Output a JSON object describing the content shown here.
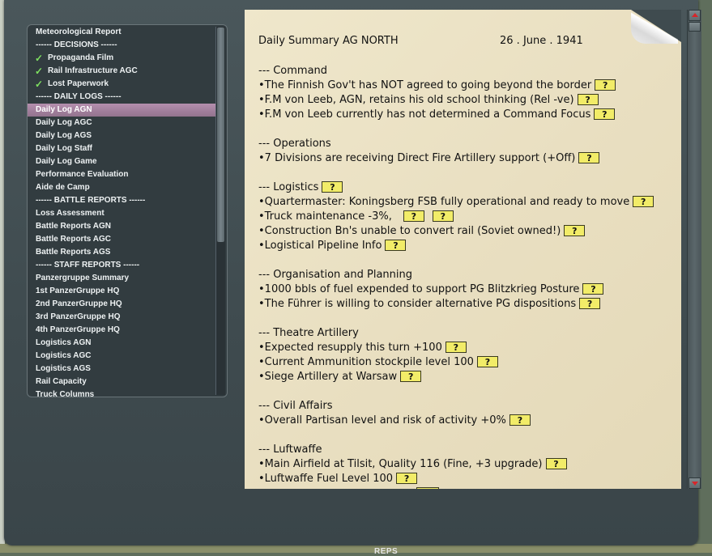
{
  "menu": {
    "items": [
      {
        "label": "Meteorological Report",
        "kind": "item"
      },
      {
        "label": "------ DECISIONS ------",
        "kind": "header"
      },
      {
        "label": "Propaganda Film",
        "kind": "checked"
      },
      {
        "label": "Rail Infrastructure AGC",
        "kind": "checked"
      },
      {
        "label": "Lost Paperwork",
        "kind": "checked"
      },
      {
        "label": "------ DAILY LOGS ------",
        "kind": "header"
      },
      {
        "label": "Daily Log AGN",
        "kind": "selected"
      },
      {
        "label": "Daily Log AGC",
        "kind": "item"
      },
      {
        "label": "Daily Log AGS",
        "kind": "item"
      },
      {
        "label": "Daily Log Staff",
        "kind": "item"
      },
      {
        "label": "Daily Log Game",
        "kind": "item"
      },
      {
        "label": "Performance Evaluation",
        "kind": "item"
      },
      {
        "label": "Aide de Camp",
        "kind": "item"
      },
      {
        "label": "------ BATTLE REPORTS ------",
        "kind": "header"
      },
      {
        "label": "Loss Assessment",
        "kind": "item"
      },
      {
        "label": "Battle Reports AGN",
        "kind": "item"
      },
      {
        "label": "Battle Reports AGC",
        "kind": "item"
      },
      {
        "label": "Battle Reports AGS",
        "kind": "item"
      },
      {
        "label": "------ STAFF REPORTS ------",
        "kind": "header"
      },
      {
        "label": "Panzergruppe Summary",
        "kind": "item"
      },
      {
        "label": "1st PanzerGruppe HQ",
        "kind": "item"
      },
      {
        "label": "2nd PanzerGruppe HQ",
        "kind": "item"
      },
      {
        "label": "3rd PanzerGruppe HQ",
        "kind": "item"
      },
      {
        "label": "4th PanzerGruppe HQ",
        "kind": "item"
      },
      {
        "label": "Logistics AGN",
        "kind": "item"
      },
      {
        "label": "Logistics AGC",
        "kind": "item"
      },
      {
        "label": "Logistics AGS",
        "kind": "item"
      },
      {
        "label": "Rail Capacity",
        "kind": "item"
      },
      {
        "label": "Truck Columns",
        "kind": "item"
      }
    ],
    "check_glyph": "✓"
  },
  "document": {
    "title": "Daily Summary AG NORTH",
    "date": "26 . June . 1941",
    "help_label": "?",
    "lines": [
      {
        "text": "--- Command",
        "buttons": 0
      },
      {
        "text": "•The Finnish Gov't has NOT agreed to going beyond the border",
        "buttons": 1
      },
      {
        "text": "•F.M von Leeb, AGN, retains his old school thinking (Rel -ve)",
        "buttons": 1
      },
      {
        "text": "•F.M von Leeb currently has not determined a Command Focus",
        "buttons": 1
      },
      {
        "text": "",
        "buttons": 0
      },
      {
        "text": "--- Operations",
        "buttons": 0
      },
      {
        "text": "•7 Divisions are receiving Direct Fire Artillery support (+Off)",
        "buttons": 1
      },
      {
        "text": "",
        "buttons": 0
      },
      {
        "text": "--- Logistics",
        "buttons": 1
      },
      {
        "text": "•Quartermaster: Koningsberg FSB fully operational and ready to move",
        "buttons": 1
      },
      {
        "text": "•Truck maintenance -3%,",
        "buttons": 2
      },
      {
        "text": "•Construction Bn's unable to convert rail (Soviet owned!)",
        "buttons": 1
      },
      {
        "text": "•Logistical Pipeline Info",
        "buttons": 1
      },
      {
        "text": "",
        "buttons": 0
      },
      {
        "text": "--- Organisation and Planning",
        "buttons": 0
      },
      {
        "text": "•1000 bbls of fuel expended to support PG Blitzkrieg Posture",
        "buttons": 1
      },
      {
        "text": "•The Führer is willing to consider alternative PG dispositions",
        "buttons": 1
      },
      {
        "text": "",
        "buttons": 0
      },
      {
        "text": "--- Theatre Artillery",
        "buttons": 0
      },
      {
        "text": "•Expected resupply this turn +100",
        "buttons": 1
      },
      {
        "text": "•Current Ammunition stockpile level 100",
        "buttons": 1
      },
      {
        "text": "•Siege Artillery at Warsaw",
        "buttons": 1
      },
      {
        "text": "",
        "buttons": 0
      },
      {
        "text": "--- Civil Affairs",
        "buttons": 0
      },
      {
        "text": "•Overall Partisan level and risk of activity +0%",
        "buttons": 1
      },
      {
        "text": "",
        "buttons": 0
      },
      {
        "text": "--- Luftwaffe",
        "buttons": 0
      },
      {
        "text": "•Main Airfield at Tilsit, Quality 116 (Fine, +3 upgrade)",
        "buttons": 1
      },
      {
        "text": "•Luftwaffe Fuel Level  100",
        "buttons": 1
      }
    ]
  },
  "background_label": "REPS",
  "colors": {
    "selected_bg": "#a8839f",
    "check": "#7ee060",
    "help_button": "#f2ec68",
    "paper": "#ebe2c4",
    "scroll_arrow": "#d7262a"
  }
}
